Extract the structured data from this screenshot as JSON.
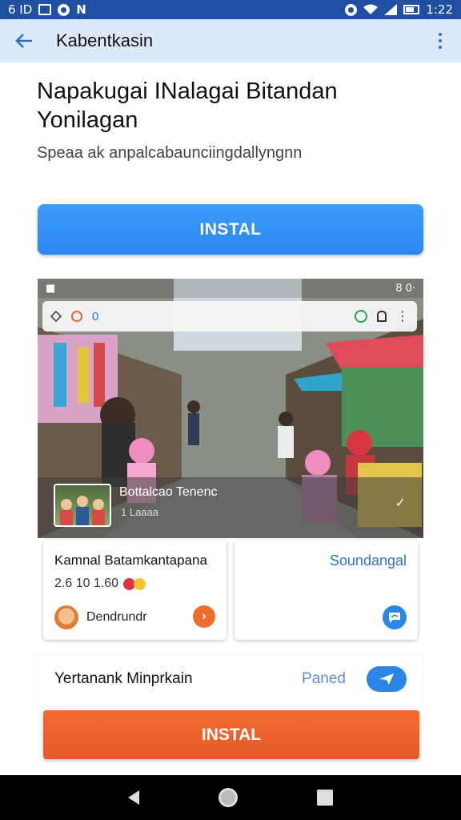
{
  "status_bar": {
    "left_text": "6 ID",
    "time": "1:22"
  },
  "app_bar": {
    "title": "Kabentkasin"
  },
  "headline": "Napakugai INalagai Bitandan Yonilagan",
  "subtitle": "Speaa ak anpalcabaunciingdallyngnn",
  "install_top_label": "INSTAL",
  "preview": {
    "status_right": "8 0·",
    "toolbar_text": "0",
    "caption_title": "Bottalcao Tenenc",
    "caption_sub": "1 Laaaa"
  },
  "card_left": {
    "title": "Kamnal Batamkantapana",
    "meta": "2.6 10 1.60",
    "author": "Dendrundr"
  },
  "card_right": {
    "title": "Soundangal"
  },
  "bottom_row": {
    "label": "Yertanank Minprkain",
    "status": "Paned"
  },
  "install_bottom_label": "INSTAL",
  "colors": {
    "status_bar": "#1e4fa0",
    "app_bar": "#dbe9fb",
    "primary_blue": "#2a87f0",
    "primary_orange": "#ef6c2b"
  },
  "icons": [
    "back-arrow-icon",
    "more-vert-icon",
    "chevron-right-icon",
    "message-icon",
    "send-icon",
    "wifi-icon",
    "signal-icon",
    "battery-icon"
  ]
}
